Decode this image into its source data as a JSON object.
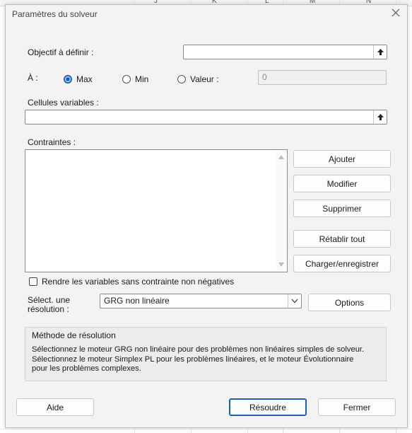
{
  "dialog": {
    "title": "Paramètres du solveur"
  },
  "objective": {
    "label": "Objectif à définir :",
    "value": ""
  },
  "target": {
    "label": "À :",
    "options": [
      {
        "label": "Max",
        "selected": true
      },
      {
        "label": "Min",
        "selected": false
      },
      {
        "label": "Valeur :",
        "selected": false
      }
    ],
    "value": "0"
  },
  "variables": {
    "label": "Cellules variables :",
    "value": ""
  },
  "constraints": {
    "label": "Contraintes :",
    "items": []
  },
  "constraint_buttons": {
    "add": "Ajouter",
    "modify": "Modifier",
    "delete": "Supprimer",
    "reset": "Rétablir tout",
    "load_save": "Charger/enregistrer"
  },
  "nonneg": {
    "label": "Rendre les variables sans contrainte non négatives",
    "checked": false
  },
  "method_select": {
    "label_line1": "Sélect. une",
    "label_line2": "résolution :",
    "value": "GRG non linéaire",
    "options_button": "Options"
  },
  "method_info": {
    "title": "Méthode de résolution",
    "lines": [
      "Sélectionnez le moteur GRG non linéaire pour des problèmes non linéaires simples de solveur.",
      "Sélectionnez le moteur Simplex PL pour les problèmes linéaires, et le moteur Évolutionnaire",
      "pour les problèmes complexes."
    ]
  },
  "footer": {
    "help": "Aide",
    "solve": "Résoudre",
    "close": "Fermer"
  },
  "background": {
    "column_letters": [
      "J",
      "K",
      "L",
      "M",
      "N"
    ]
  },
  "colors": {
    "accent": "#1a5fb4",
    "dialog_bg": "#f3f3f3",
    "panel_bg": "#ececec"
  }
}
